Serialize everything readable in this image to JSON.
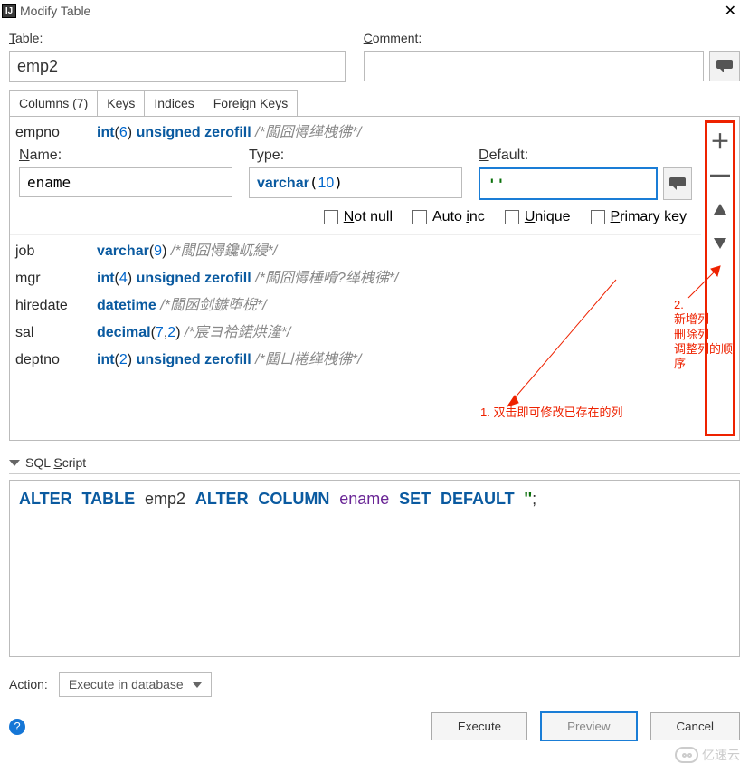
{
  "title_bar": {
    "title": "Modify Table",
    "close": "✕",
    "icon_letter": "IJ"
  },
  "form": {
    "table_label": "Table:",
    "table_value": "emp2",
    "comment_label": "Comment:",
    "comment_value": ""
  },
  "tabs": {
    "columns": "Columns (7)",
    "keys": "Keys",
    "indices": "Indices",
    "foreign": "Foreign Keys"
  },
  "col_first": {
    "name": "empno",
    "type": "int",
    "type_num": "6",
    "extra": "unsigned zerofill",
    "comment": "/*闆囧憳缂栧彿*/"
  },
  "expanded": {
    "name_label": "Name:",
    "name_value": "ename",
    "type_label": "Type:",
    "type_value_pre": "varchar",
    "type_value_num": "10",
    "default_label": "Default:",
    "default_value": "''",
    "checks": {
      "notnull": "Not null",
      "autoinc": "Auto inc",
      "unique": "Unique",
      "primary": "Primary key"
    }
  },
  "rows": [
    {
      "name": "job",
      "type": "varchar",
      "num": "9",
      "extra": "",
      "comment": "/*闆囧憳鑱屼綅*/"
    },
    {
      "name": "mgr",
      "type": "int",
      "num": "4",
      "extra": "unsigned zerofill",
      "comment": "/*闆囧憳棰嗗?缂栧彿*/"
    },
    {
      "name": "hiredate",
      "type": "datetime",
      "num": "",
      "extra": "",
      "comment": "/*闆囦剑鏃堕棿*/"
    },
    {
      "name": "sal",
      "type": "decimal",
      "num": "7,2",
      "num_a": "7",
      "num_b": "2",
      "extra": "",
      "comment": "/*宸ヨ祫鍩烘湰*/"
    },
    {
      "name": "deptno",
      "type": "int",
      "num": "2",
      "extra": "unsigned zerofill",
      "comment": "/*閮ㄩ棬缂栧彿*/"
    }
  ],
  "side_buttons": {
    "add": "＋",
    "remove": "—"
  },
  "annotations": {
    "a1": "1. 双击即可修改已存在的列",
    "a2_line1": "2.",
    "a2_line2": "新增列",
    "a2_line3": "删除列",
    "a2_line4": "调整列的顺",
    "a2_line5": "序"
  },
  "sql": {
    "header": "SQL Script",
    "line": {
      "alter": "ALTER",
      "table": "TABLE",
      "tname": "emp2",
      "alter2": "ALTER",
      "column": "COLUMN",
      "field": "ename",
      "set": "SET",
      "default": "DEFAULT",
      "val": "''",
      "semi": ";"
    }
  },
  "action": {
    "label": "Action:",
    "value": "Execute in database"
  },
  "footer": {
    "execute": "Execute",
    "preview": "Preview",
    "cancel": "Cancel"
  },
  "watermark": "亿速云"
}
